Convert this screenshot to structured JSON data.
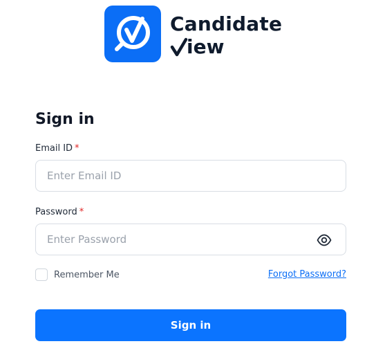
{
  "brand": {
    "name_line1": "Candidate",
    "name_line2": "iew",
    "logo_icon": "check-in-magnifier-icon",
    "accent_color": "#0b6ef6"
  },
  "signin": {
    "title": "Sign in",
    "email": {
      "label": "Email ID",
      "required_mark": "*",
      "placeholder": "Enter Email ID",
      "value": ""
    },
    "password": {
      "label": "Password",
      "required_mark": "*",
      "placeholder": "Enter Password",
      "value": "",
      "toggle_icon": "eye-icon"
    },
    "remember": {
      "label": "Remember Me",
      "checked": false
    },
    "forgot_label": "Forgot Password?",
    "submit_label": "Sign in",
    "button_color": "#0b74ff",
    "required_color": "#e02424"
  }
}
